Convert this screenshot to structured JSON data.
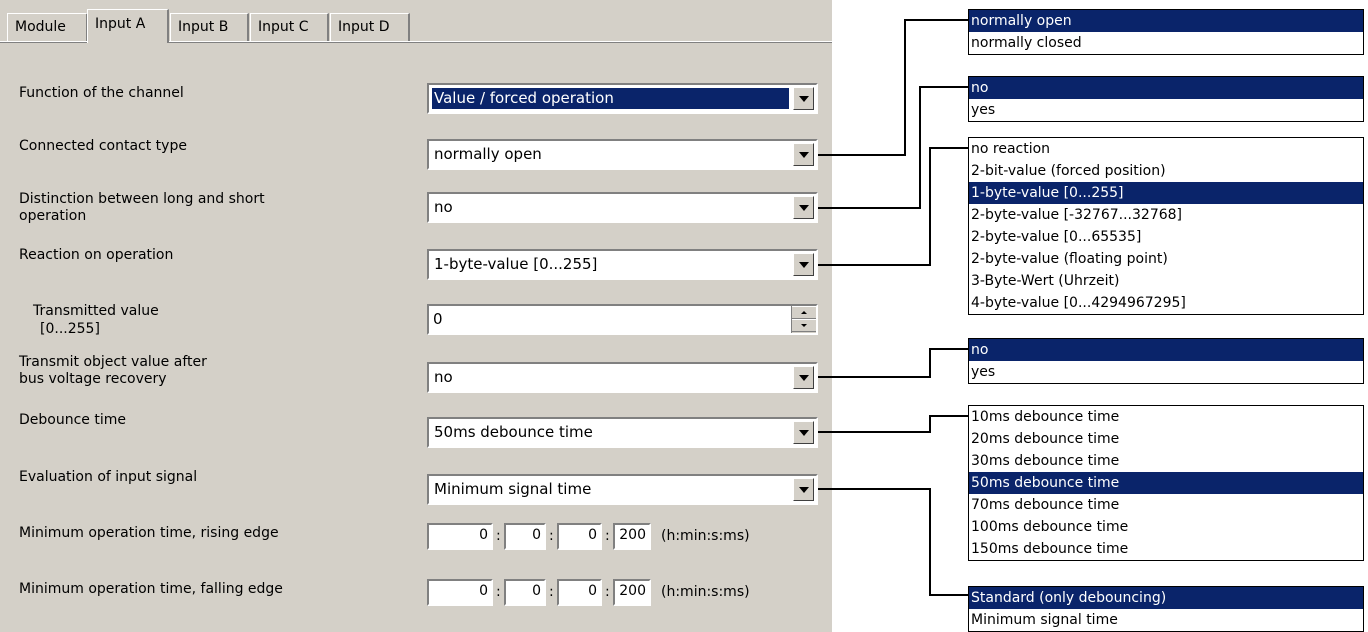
{
  "tabs": [
    {
      "label": "Module",
      "active": false
    },
    {
      "label": "Input A",
      "active": true
    },
    {
      "label": "Input B",
      "active": false
    },
    {
      "label": "Input C",
      "active": false
    },
    {
      "label": "Input D",
      "active": false
    }
  ],
  "params": {
    "function_label": "Function of the channel",
    "function_value": "Value / forced operation",
    "contact_label": "Connected contact type",
    "contact_value": "normally open",
    "distinction_label_1": "Distinction between long and short",
    "distinction_label_2": "operation",
    "distinction_value": "no",
    "reaction_label": "Reaction on operation",
    "reaction_value": "1-byte-value [0...255]",
    "transmitted_label_1": "Transmitted value",
    "transmitted_label_2": "[0...255]",
    "transmitted_value": "0",
    "transmit_after_label_1": "Transmit object value after",
    "transmit_after_label_2": "bus voltage recovery",
    "transmit_after_value": "no",
    "debounce_label": "Debounce time",
    "debounce_value": "50ms debounce time",
    "evaluation_label": "Evaluation of input signal",
    "evaluation_value": "Minimum signal time",
    "min_rising_label": "Minimum operation time, rising edge",
    "min_rising": {
      "h": "0",
      "min": "0",
      "s": "0",
      "ms": "200"
    },
    "min_falling_label": "Minimum operation time, falling edge",
    "min_falling": {
      "h": "0",
      "min": "0",
      "s": "0",
      "ms": "200"
    },
    "time_unit": "(h:min:s:ms)",
    "colon": ":"
  },
  "dropdowns": {
    "contact_options": [
      "normally open",
      "normally closed"
    ],
    "distinction_options": [
      "no",
      "yes"
    ],
    "reaction_options": [
      "no reaction",
      "2-bit-value (forced position)",
      "1-byte-value [0...255]",
      "2-byte-value [-32767...32768]",
      "2-byte-value [0...65535]",
      "2-byte-value (floating point)",
      "3-Byte-Wert (Uhrzeit)",
      "4-byte-value [0...4294967295]"
    ],
    "transmit_options": [
      "no",
      "yes"
    ],
    "debounce_options": [
      "10ms debounce time",
      "20ms debounce time",
      "30ms debounce time",
      "50ms debounce time",
      "70ms debounce time",
      "100ms debounce time",
      "150ms debounce time"
    ],
    "evaluation_options": [
      "Standard (only debouncing)",
      "Minimum signal time"
    ]
  },
  "colors": {
    "panel_bg": "#d4d0c8",
    "selection": "#0a246a",
    "selection_text": "#ffffff"
  }
}
